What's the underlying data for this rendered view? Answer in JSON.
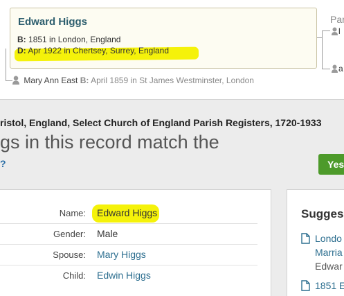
{
  "tree": {
    "person_name": "Edward Higgs",
    "birth": {
      "label": "B:",
      "value": "1851 in London, England"
    },
    "death": {
      "label": "D:",
      "value": "Apr 1922 in Chertsey, Surrey, England"
    },
    "parents_label": "Par",
    "parent_stub_1": "l",
    "parent_stub_2": "a",
    "spouse": {
      "name": "Mary Ann East",
      "birth_label": "B:",
      "birth_value": "April 1859 in St James Westminster, London"
    }
  },
  "record": {
    "collection_title": "ristol, England, Select Church of England Parish Registers, 1720-1933",
    "match_question": "gs in this record match the",
    "help_glyph": "?",
    "yes_button": "Yes",
    "facts": [
      {
        "label": "Name:",
        "value": "Edward Higgs",
        "link": false
      },
      {
        "label": "Gender:",
        "value": "Male",
        "link": false
      },
      {
        "label": "Spouse:",
        "value": "Mary Higgs",
        "link": true
      },
      {
        "label": "Child:",
        "value": "Edwin Higgs",
        "link": true
      }
    ],
    "suggested": {
      "title": "Sugges",
      "items": [
        {
          "line1": "Londo",
          "line2": "Marria",
          "line3": "Edwar"
        },
        {
          "line1": "1851 E"
        }
      ]
    }
  },
  "colors": {
    "highlight": "#f5f20a",
    "link": "#2c6e8f",
    "yes_button": "#4d9a2a",
    "name": "#2d5e6e"
  }
}
